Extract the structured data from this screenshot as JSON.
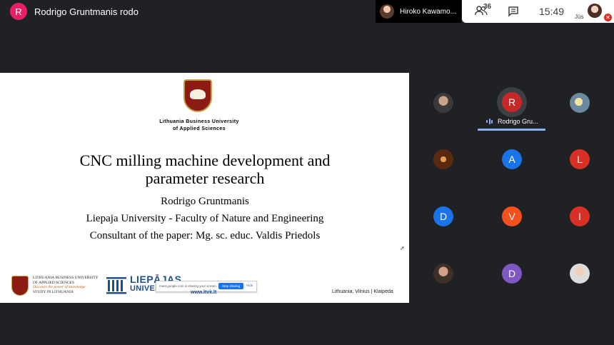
{
  "topbar": {
    "presenter": {
      "initial": "R",
      "name": "Rodrigo Gruntmanis rodo",
      "color": "#e91e63"
    },
    "pinned": {
      "name": "Hiroko Kawamo..."
    },
    "participants_count": "36",
    "clock": "15:49",
    "self_label": "Jūs"
  },
  "slide": {
    "university": [
      "Lithuania Business University",
      "of Applied Sciences"
    ],
    "title": [
      "CNC milling machine development and",
      "parameter research"
    ],
    "author": "Rodrigo Gruntmanis",
    "affiliation": "Liepaja University - Faculty of Nature and Engineering",
    "consultant": "Consultant of the paper: Mg. sc. educ. Valdis Priedols",
    "footer": {
      "ltvk_lines": [
        "LITHUANIA BUSINESS UNIVERSITY",
        "OF APPLIED SCIENCES"
      ],
      "ltvk_tag": "Discover the power of knowledge",
      "ltvk_sub": "STUDY IN LITHUANIA",
      "liepaja_line1": "LIEPĀJAS",
      "liepaja_line2": "UNIVERSITĀTE",
      "website": "www.ltvk.lt",
      "location": "Lithuania, Vilnius | Klaipėda"
    },
    "share_bar": {
      "text": "meet.google.com is sharing your screen.",
      "stop_label": "Stop sharing",
      "hide_label": "Hide"
    }
  },
  "grid": {
    "active_speaker": {
      "initial": "R",
      "name": "Rodrigo Gru..."
    },
    "tiles": [
      {
        "initial": "A",
        "color": "#1a73e8"
      },
      {
        "initial": "L",
        "color": "#d93025"
      },
      {
        "initial": "D",
        "color": "#1a73e8"
      },
      {
        "initial": "V",
        "color": "#f4511e"
      },
      {
        "initial": "I",
        "color": "#d93025"
      },
      {
        "initial": "D",
        "color": "#7e57c2"
      }
    ],
    "colors": {
      "speaking_accent": "#8ab4f8",
      "active_avatar": "#c62828"
    }
  }
}
